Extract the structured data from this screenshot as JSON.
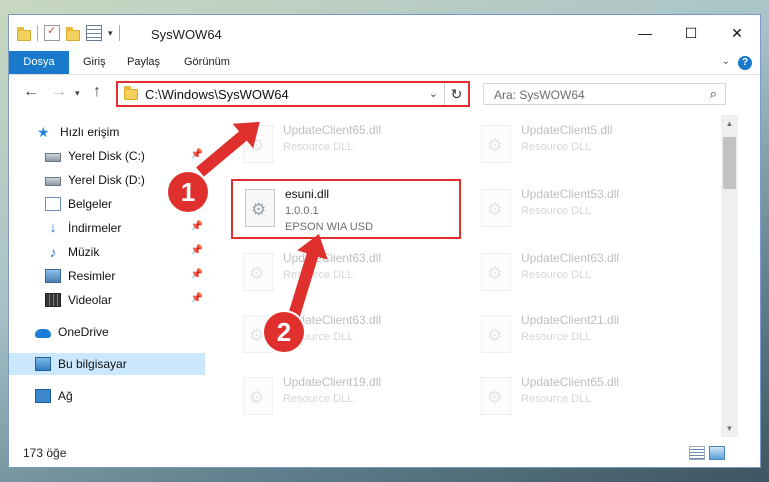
{
  "window": {
    "title": "SysWOW64",
    "controls": {
      "minimize": "—",
      "maximize": "☐",
      "close": "✕"
    }
  },
  "ribbon": {
    "tabs": [
      "Dosya",
      "Giriş",
      "Paylaş",
      "Görünüm"
    ],
    "help": "?"
  },
  "address": {
    "path": "C:\\Windows\\SysWOW64",
    "search_placeholder": "Ara: SysWOW64"
  },
  "navpane": {
    "items": [
      {
        "label": "Hızlı erişim",
        "icon": "star-icon",
        "pinned": false
      },
      {
        "label": "Yerel Disk (C:)",
        "icon": "drive-icon",
        "pinned": true
      },
      {
        "label": "Yerel Disk (D:)",
        "icon": "drive-icon",
        "pinned": true
      },
      {
        "label": "Belgeler",
        "icon": "documents-icon",
        "pinned": true
      },
      {
        "label": "İndirmeler",
        "icon": "download-icon",
        "pinned": true
      },
      {
        "label": "Müzik",
        "icon": "music-icon",
        "pinned": true
      },
      {
        "label": "Resimler",
        "icon": "pictures-icon",
        "pinned": true
      },
      {
        "label": "Videolar",
        "icon": "videos-icon",
        "pinned": true
      },
      {
        "label": "OneDrive",
        "icon": "onedrive-icon",
        "pinned": false
      },
      {
        "label": "Bu bilgisayar",
        "icon": "this-pc-icon",
        "pinned": false,
        "selected": true
      },
      {
        "label": "Ağ",
        "icon": "network-icon",
        "pinned": false
      }
    ]
  },
  "files": [
    {
      "name": "UpdateClient65.dll",
      "desc": "Resource DLL",
      "faded": true
    },
    {
      "name": "UpdateClient5.dll",
      "desc": "Resource DLL",
      "faded": true
    },
    {
      "name": "esuni.dll",
      "version": "1.0.0.1",
      "desc": "EPSON WIA USD",
      "faded": false,
      "highlighted": true
    },
    {
      "name": "UpdateClient53.dll",
      "desc": "Resource DLL",
      "faded": true
    },
    {
      "name": "UpdateClient63.dll",
      "desc": "Resource DLL",
      "faded": true
    },
    {
      "name": "UpdateClient63.dll",
      "desc": "Resource DLL",
      "faded": true
    },
    {
      "name": "UpdateClient63.dll",
      "desc": "Resource DLL",
      "faded": true
    },
    {
      "name": "UpdateClient21.dll",
      "desc": "Resource DLL",
      "faded": true
    },
    {
      "name": "UpdateClient19.dll",
      "desc": "Resource DLL",
      "faded": true
    },
    {
      "name": "UpdateClient65.dll",
      "desc": "Resource DLL",
      "faded": true
    }
  ],
  "status": {
    "count": "173 öğe"
  },
  "annotations": {
    "step1": "1",
    "step2": "2",
    "color": "#e0302e"
  }
}
